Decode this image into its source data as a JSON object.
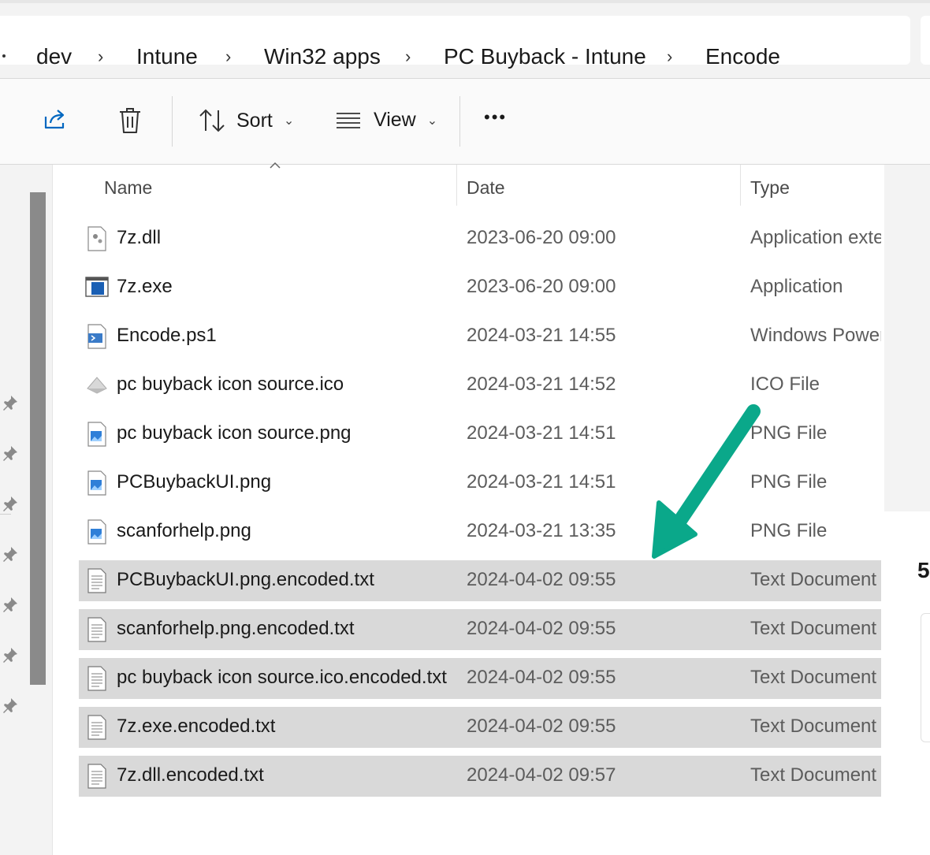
{
  "breadcrumb": [
    "dev",
    "Intune",
    "Win32 apps",
    "PC Buyback - Intune",
    "Encode"
  ],
  "toolbar": {
    "share_icon": "share-icon",
    "delete_icon": "trash-icon",
    "sort_label": "Sort",
    "view_label": "View",
    "more_label": "•••"
  },
  "columns": {
    "name": "Name",
    "date": "Date",
    "type": "Type"
  },
  "files": [
    {
      "name": "7z.dll",
      "date": "2023-06-20 09:00",
      "type": "Application exte",
      "icon": "dll-icon",
      "selected": false
    },
    {
      "name": "7z.exe",
      "date": "2023-06-20 09:00",
      "type": "Application",
      "icon": "exe-icon",
      "selected": false
    },
    {
      "name": "Encode.ps1",
      "date": "2024-03-21 14:55",
      "type": "Windows Power",
      "icon": "powershell-icon",
      "selected": false
    },
    {
      "name": "pc buyback icon source.ico",
      "date": "2024-03-21 14:52",
      "type": "ICO File",
      "icon": "ico-icon",
      "selected": false
    },
    {
      "name": "pc buyback icon source.png",
      "date": "2024-03-21 14:51",
      "type": "PNG File",
      "icon": "image-icon",
      "selected": false
    },
    {
      "name": "PCBuybackUI.png",
      "date": "2024-03-21 14:51",
      "type": "PNG File",
      "icon": "image-icon",
      "selected": false
    },
    {
      "name": "scanforhelp.png",
      "date": "2024-03-21 13:35",
      "type": "PNG File",
      "icon": "image-icon",
      "selected": false
    },
    {
      "name": "PCBuybackUI.png.encoded.txt",
      "date": "2024-04-02 09:55",
      "type": "Text Document",
      "icon": "text-file-icon",
      "selected": true
    },
    {
      "name": "scanforhelp.png.encoded.txt",
      "date": "2024-04-02 09:55",
      "type": "Text Document",
      "icon": "text-file-icon",
      "selected": true
    },
    {
      "name": "pc buyback icon source.ico.encoded.txt",
      "date": "2024-04-02 09:55",
      "type": "Text Document",
      "icon": "text-file-icon",
      "selected": true
    },
    {
      "name": "7z.exe.encoded.txt",
      "date": "2024-04-02 09:55",
      "type": "Text Document",
      "icon": "text-file-icon",
      "selected": true
    },
    {
      "name": "7z.dll.encoded.txt",
      "date": "2024-04-02 09:57",
      "type": "Text Document",
      "icon": "text-file-icon",
      "selected": true
    }
  ],
  "details_count": "5",
  "colors": {
    "selection": "#d9d9d9",
    "arrow": "#0aa88a",
    "accent": "#0067c0"
  }
}
